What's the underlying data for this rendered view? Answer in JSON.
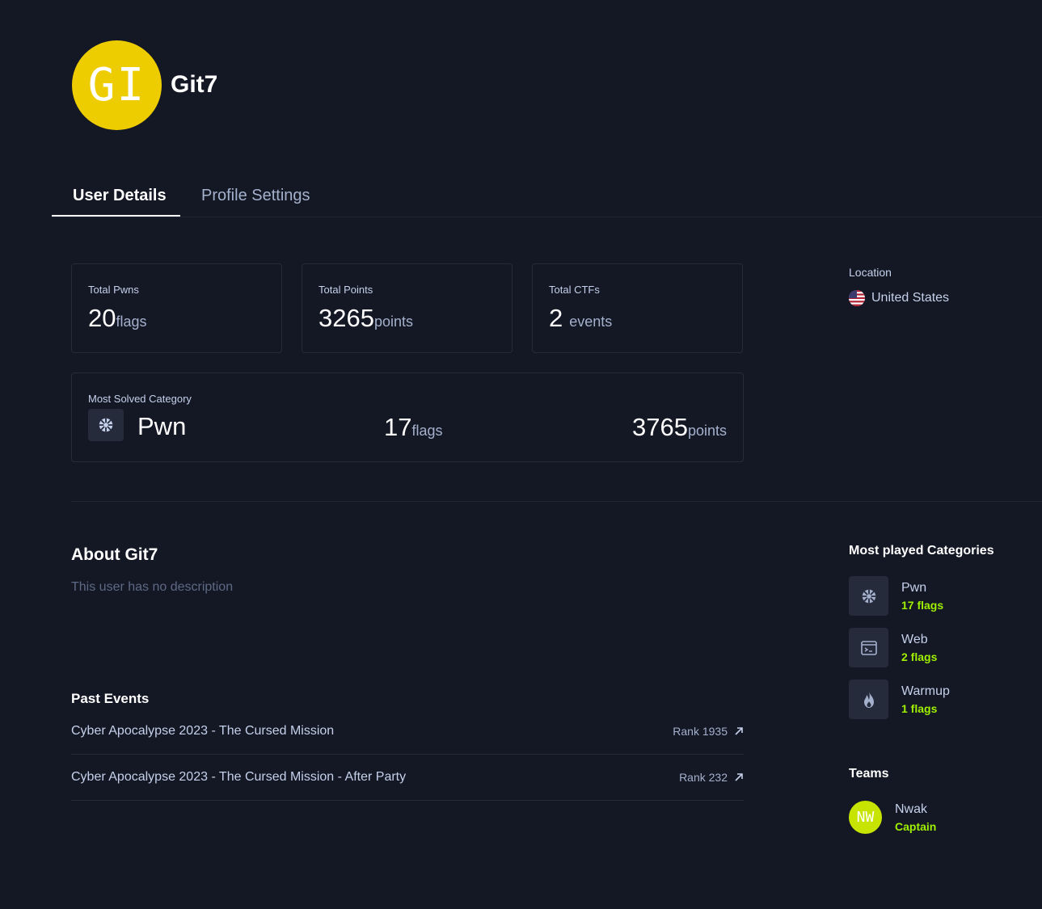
{
  "user": {
    "avatar_initials": "GI",
    "avatar_color": "#eecd00",
    "name": "Git7"
  },
  "tabs": [
    {
      "label": "User Details",
      "active": true
    },
    {
      "label": "Profile Settings",
      "active": false
    }
  ],
  "stats": {
    "total_pwns": {
      "label": "Total Pwns",
      "value": "20",
      "unit": "flags"
    },
    "total_points": {
      "label": "Total Points",
      "value": "3265",
      "unit": "points"
    },
    "total_ctfs": {
      "label": "Total CTFs",
      "value": "2",
      "unit": "events"
    }
  },
  "most_solved": {
    "label": "Most Solved Category",
    "category": "Pwn",
    "icon": "pwn-icon",
    "flags_value": "17",
    "flags_unit": "flags",
    "points_value": "3765",
    "points_unit": "points"
  },
  "location": {
    "label": "Location",
    "country": "United States",
    "icon": "us-flag-icon"
  },
  "about": {
    "title": "About Git7",
    "description": "This user has no description"
  },
  "past_events": {
    "title": "Past Events",
    "items": [
      {
        "name": "Cyber Apocalypse 2023 - The Cursed Mission",
        "rank": "Rank 1935"
      },
      {
        "name": "Cyber Apocalypse 2023 - The Cursed Mission - After Party",
        "rank": "Rank 232"
      }
    ]
  },
  "most_played": {
    "title": "Most played Categories",
    "items": [
      {
        "name": "Pwn",
        "flags": "17 flags",
        "icon": "pwn-icon"
      },
      {
        "name": "Web",
        "flags": "2 flags",
        "icon": "terminal-window-icon"
      },
      {
        "name": "Warmup",
        "flags": "1 flags",
        "icon": "flame-icon"
      }
    ]
  },
  "teams": {
    "title": "Teams",
    "items": [
      {
        "initials": "NW",
        "name": "Nwak",
        "role": "Captain",
        "avatar_color": "#c6e400"
      }
    ]
  },
  "colors": {
    "background": "#141724",
    "accent_green": "#9fef00",
    "muted_text": "#a4b1cd",
    "card_border": "#262a3b"
  }
}
